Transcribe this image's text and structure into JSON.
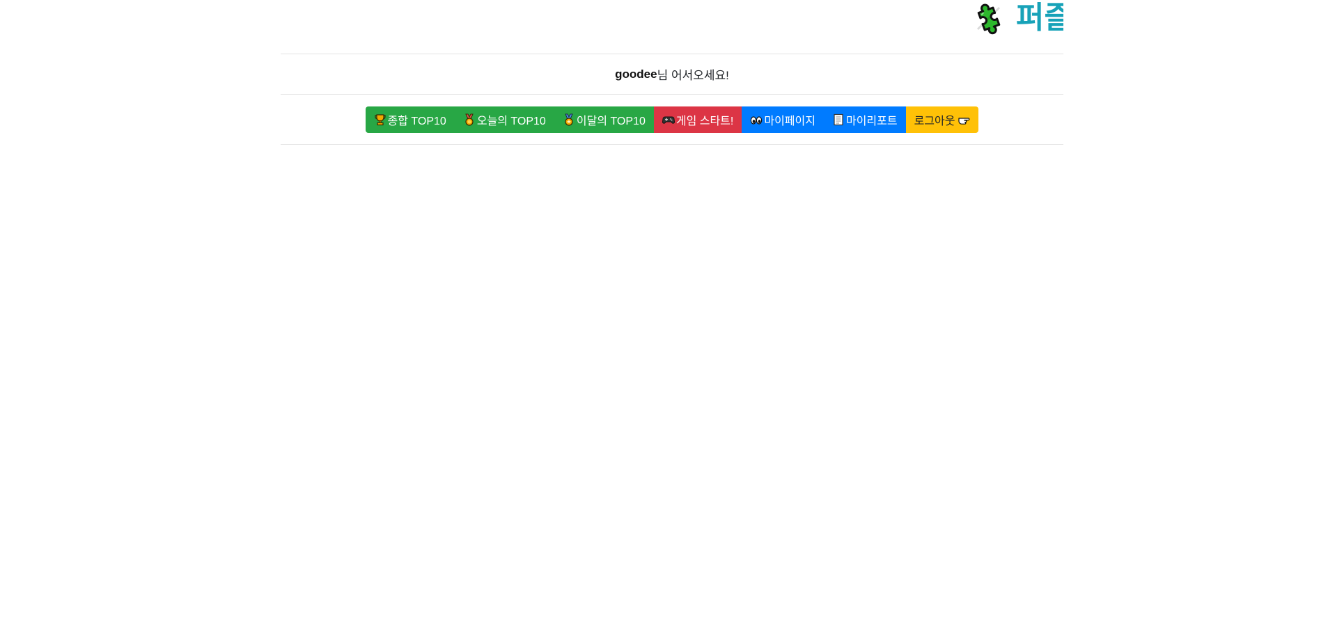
{
  "header": {
    "logo_text": "퍼즐",
    "logo_icon": "puzzle-piece-icon",
    "brand_color": "#17a2b8"
  },
  "welcome": {
    "username": "goodee",
    "message": "님 어서오세요!"
  },
  "nav": {
    "buttons": [
      {
        "label": "종합 TOP10",
        "icon": "trophy-icon",
        "color": "#28a745"
      },
      {
        "label": "오늘의 TOP10",
        "icon": "medal-icon",
        "color": "#28a745"
      },
      {
        "label": "이달의 TOP10",
        "icon": "military-medal-icon",
        "color": "#28a745"
      },
      {
        "label": "게임 스타트!",
        "icon": "gamepad-icon",
        "color": "#dc3545"
      },
      {
        "label": "마이페이지",
        "icon": "eyes-icon",
        "color": "#007bff"
      },
      {
        "label": "마이리포트",
        "icon": "page-icon",
        "color": "#007bff"
      },
      {
        "label": "로그아웃",
        "icon": "pointing-hand-icon",
        "color": "#ffc107"
      }
    ]
  }
}
